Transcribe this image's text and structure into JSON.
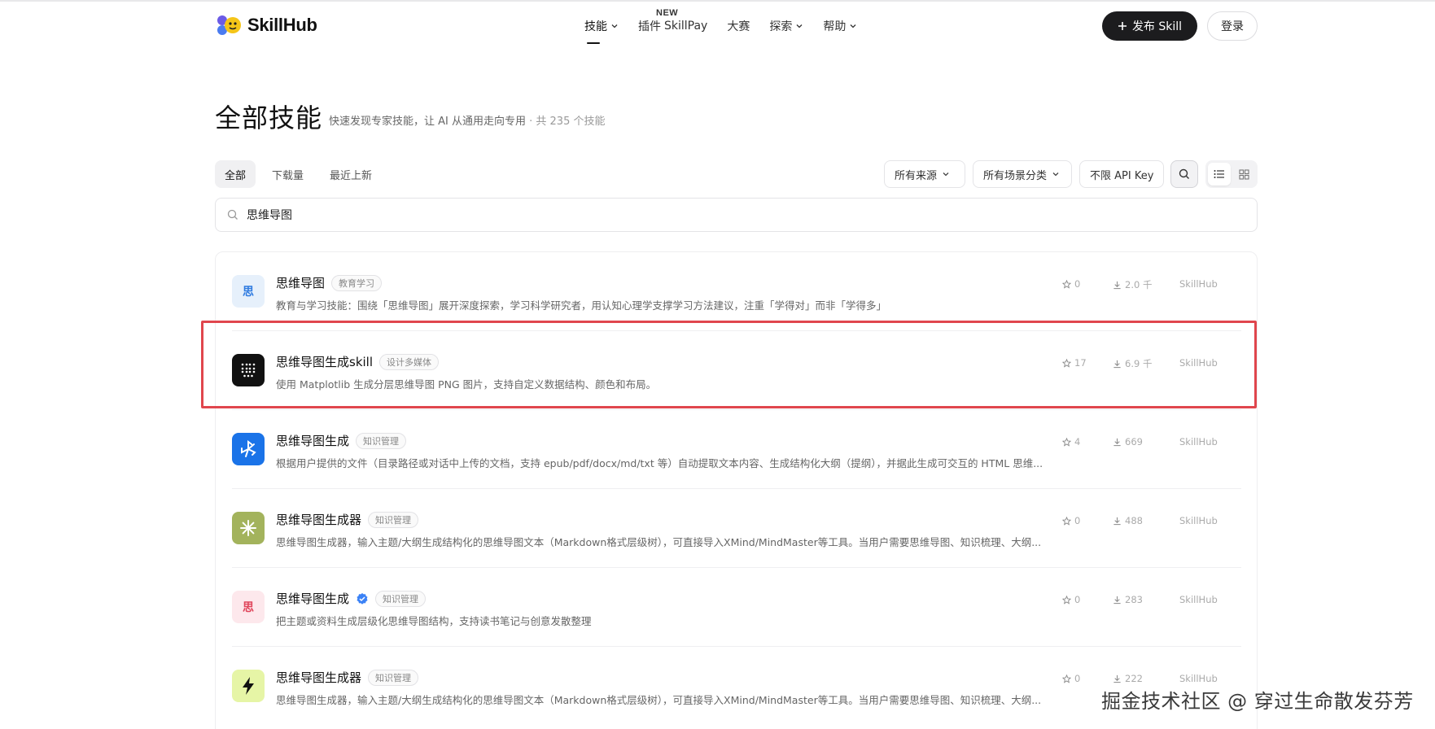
{
  "header": {
    "logo_text": "SkillHub",
    "nav": [
      {
        "label": "技能",
        "has_menu": true,
        "active": true
      },
      {
        "label": "插件",
        "badge": "NEW"
      },
      {
        "label": "SkillPay"
      },
      {
        "label": "大赛"
      },
      {
        "label": "探索",
        "has_menu": true
      },
      {
        "label": "帮助",
        "has_menu": true
      }
    ],
    "publish_label": "发布 Skill",
    "login_label": "登录"
  },
  "page": {
    "title": "全部技能",
    "subtitle": "快速发现专家技能，让 AI 从通用走向专用",
    "count_text": " · 共 235 个技能"
  },
  "tabs": [
    {
      "label": "全部",
      "active": true
    },
    {
      "label": "下载量"
    },
    {
      "label": "最近上新"
    }
  ],
  "filters": {
    "source": "所有来源",
    "scene": "所有场景分类",
    "api_key": "不限 API Key"
  },
  "search": {
    "value": "思维导图"
  },
  "skills": [
    {
      "name": "思维导图",
      "tag": "教育学习",
      "desc": "教育与学习技能：围绕「思维导图」展开深度探索，学习科学研究者，用认知心理学支撑学习方法建议，注重「学得对」而非「学得多」",
      "stars": "0",
      "downloads": "2.0 千",
      "source": "SkillHub",
      "icon_char": "思",
      "icon_bg": "#e6f0fb",
      "icon_fg": "#2f7be0",
      "icon_name": "char-icon"
    },
    {
      "name": "思维导图生成skill",
      "tag": "设计多媒体",
      "desc": "使用 Matplotlib 生成分层思维导图 PNG 图片，支持自定义数据结构、颜色和布局。",
      "stars": "17",
      "downloads": "6.9 千",
      "source": "SkillHub",
      "icon_bg": "#111111",
      "icon_name": "dot-grid-icon"
    },
    {
      "name": "思维导图生成",
      "tag": "知识管理",
      "desc": "根据用户提供的文件（目录路径或对话中上传的文档，支持 epub/pdf/docx/md/txt 等）自动提取文本内容、生成结构化大纲（提纲），并据此生成可交互的 HTML 思维...",
      "stars": "4",
      "downloads": "669",
      "source": "SkillHub",
      "icon_bg": "#1a73e8",
      "icon_name": "pinwheel-icon"
    },
    {
      "name": "思维导图生成器",
      "tag": "知识管理",
      "desc": "思维导图生成器，输入主题/大纲生成结构化的思维导图文本（Markdown格式层级树），可直接导入XMind/MindMaster等工具。当用户需要思维导图、知识梳理、大纲...",
      "stars": "0",
      "downloads": "488",
      "source": "SkillHub",
      "icon_bg": "#a3b35c",
      "icon_name": "asterisk-icon"
    },
    {
      "name": "思维导图生成",
      "tag": "知识管理",
      "verified": true,
      "desc": "把主题或资料生成层级化思维导图结构，支持读书笔记与创意发散整理",
      "stars": "0",
      "downloads": "283",
      "source": "SkillHub",
      "icon_char": "思",
      "icon_bg": "#fde8ec",
      "icon_fg": "#e0455b",
      "icon_name": "char-icon"
    },
    {
      "name": "思维导图生成器",
      "tag": "知识管理",
      "desc": "思维导图生成器，输入主题/大纲生成结构化的思维导图文本（Markdown格式层级树），可直接导入XMind/MindMaster等工具。当用户需要思维导图、知识梳理、大纲...",
      "stars": "0",
      "downloads": "222",
      "source": "SkillHub",
      "icon_bg": "#e6f5a6",
      "icon_name": "lightning-icon"
    }
  ],
  "watermark": "掘金技术社区 @ 穿过生命散发芬芳"
}
